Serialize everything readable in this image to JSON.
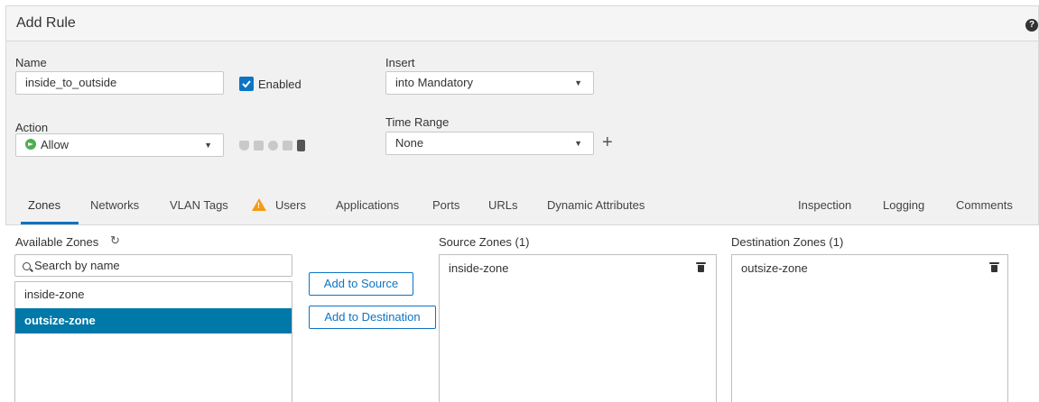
{
  "dialog": {
    "title": "Add Rule",
    "help_icon": "help-icon"
  },
  "form": {
    "name_label": "Name",
    "name_value": "inside_to_outside",
    "enabled_label": "Enabled",
    "enabled_checked": true,
    "insert_label": "Insert",
    "insert_value": "into Mandatory",
    "action_label": "Action",
    "action_value": "Allow",
    "time_range_label": "Time Range",
    "time_range_value": "None",
    "add_time_range_icon": "plus-icon"
  },
  "tabs": [
    {
      "label": "Zones",
      "active": true
    },
    {
      "label": "Networks"
    },
    {
      "label": "VLAN Tags"
    },
    {
      "label": "Users",
      "warning": true
    },
    {
      "label": "Applications"
    },
    {
      "label": "Ports"
    },
    {
      "label": "URLs"
    },
    {
      "label": "Dynamic Attributes"
    },
    {
      "label": "Inspection"
    },
    {
      "label": "Logging"
    },
    {
      "label": "Comments"
    }
  ],
  "zones": {
    "available_label": "Available Zones",
    "search_placeholder": "Search by name",
    "available": [
      {
        "name": "inside-zone",
        "selected": false
      },
      {
        "name": "outsize-zone",
        "selected": true
      }
    ],
    "add_to_source_label": "Add to Source",
    "add_to_destination_label": "Add to Destination",
    "source_label": "Source Zones (1)",
    "source": [
      "inside-zone"
    ],
    "destination_label": "Destination Zones (1)",
    "destination": [
      "outsize-zone"
    ]
  },
  "colors": {
    "accent": "#0d74c4",
    "selected_row": "#0078a8",
    "allow": "#4caf50",
    "warning": "#f39c12"
  }
}
